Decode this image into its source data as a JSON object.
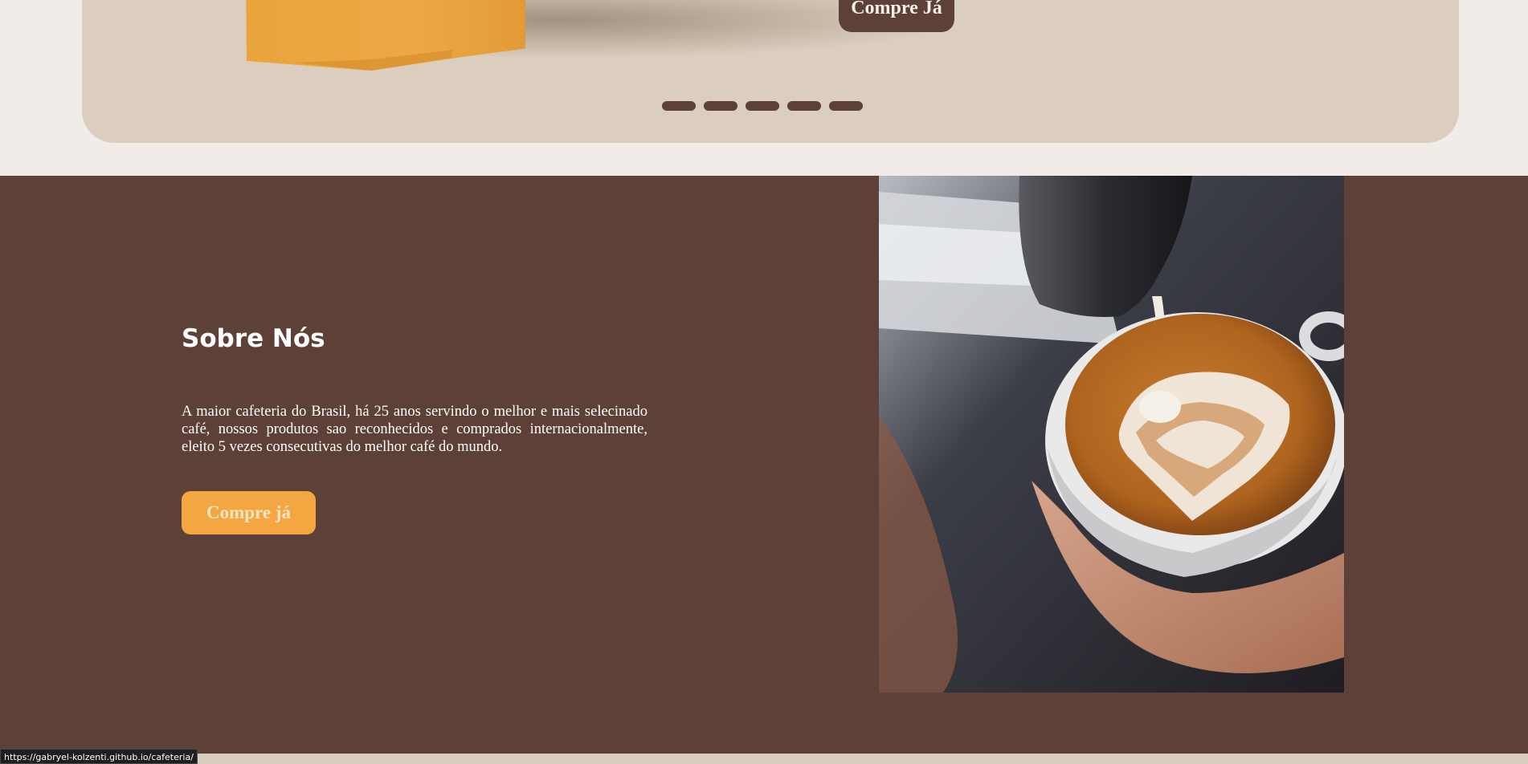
{
  "hero": {
    "cta_label": "Compre Já",
    "carousel_dots": 5,
    "colors": {
      "background": "#dbcebe",
      "button": "#5d4037",
      "bag": "#eba541"
    }
  },
  "about": {
    "title": "Sobre Nós",
    "text": "A maior cafeteria do Brasil, há 25 anos servindo o melhor e mais selecinado café, nossos produtos sao reconhecidos e comprados internacionalmente, eleito 5 vezes consecutivas do melhor café do mundo.",
    "cta_label": "Compre já",
    "image": "latte-art-photo",
    "colors": {
      "background": "#5d4037",
      "button": "#f4a640"
    }
  },
  "status_bar": {
    "url": "https://gabryel-kolzenti.github.io/cafeteria/"
  }
}
